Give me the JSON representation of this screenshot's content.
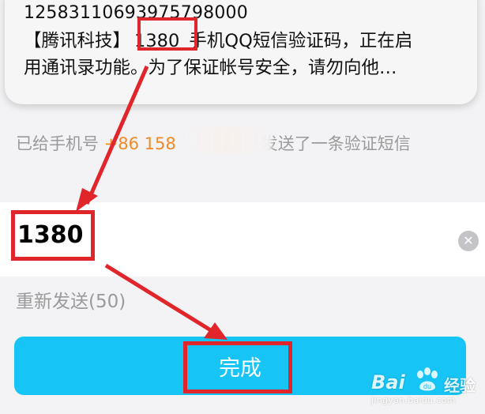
{
  "notification": {
    "sender": "12583110693975798000",
    "prefix": "【腾讯科技】",
    "code": "1380",
    "line1_rest": " 手机QQ短信验证码，正在启",
    "line2": "用通讯录功能。为了保证帐号安全，请勿向他…",
    "app_icon": "messages-app-icon"
  },
  "sent_info": {
    "prefix": "已给手机号 ",
    "phone": "+86 158",
    "suffix": "发送了一条验证短信"
  },
  "input": {
    "value": "1380",
    "clear_icon": "clear-icon",
    "clear_glyph": "✕"
  },
  "resend": {
    "label": "重新发送(50)"
  },
  "done_button": {
    "label": "完成"
  },
  "watermark": {
    "brand_bai": "Bai",
    "brand_du": "du",
    "brand_jy": "经验",
    "url": "jingyan.baidu.com"
  },
  "colors": {
    "accent": "#16c4f5",
    "highlight": "#e0262b",
    "phone": "#f08a24",
    "muted": "#9a9a9a"
  }
}
